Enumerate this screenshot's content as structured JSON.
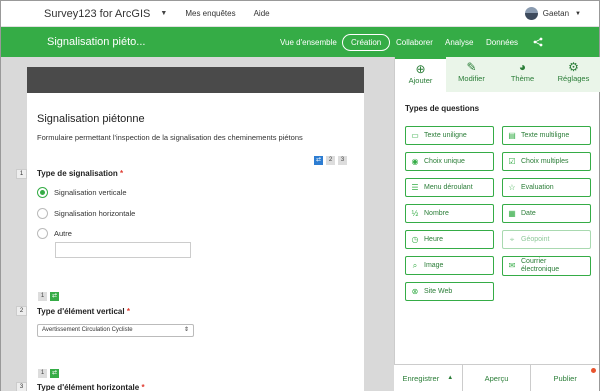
{
  "topbar": {
    "brand": "Survey123 for ArcGIS",
    "nav": [
      "Mes enquêtes",
      "Aide"
    ],
    "user": "Gaetan"
  },
  "greenbar": {
    "title": "Signalisation piéto...",
    "nav": [
      "Vue d'ensemble",
      "Création",
      "Collaborer",
      "Analyse",
      "Données"
    ],
    "active": "Création"
  },
  "form": {
    "title": "Signalisation piétonne",
    "description": "Formulaire permettant l'inspection de la signalisation des cheminements piétons",
    "q1": {
      "number": "1",
      "label": "Type de signalisation",
      "required_mark": "*",
      "options": [
        "Signalisation verticale",
        "Signalisation horizontale",
        "Autre"
      ],
      "selected": "Signalisation verticale",
      "badges": [
        "2",
        "3"
      ]
    },
    "q2": {
      "number": "2",
      "label": "Type d'élément vertical",
      "required_mark": "*",
      "badge": "1",
      "select_value": "Avertissement Circulation Cycliste"
    },
    "q3": {
      "number": "3",
      "label": "Type d'élément horizontale",
      "required_mark": "*",
      "badge": "1"
    }
  },
  "panel": {
    "tabs": [
      {
        "label": "Ajouter",
        "icon": "plus-circle-icon"
      },
      {
        "label": "Modifier",
        "icon": "pencil-icon"
      },
      {
        "label": "Thème",
        "icon": "palette-icon"
      },
      {
        "label": "Réglages",
        "icon": "settings-icon"
      }
    ],
    "active_tab": "Ajouter",
    "section_title": "Types de questions",
    "types": [
      {
        "label": "Texte uniligne",
        "icon": "text-line-icon"
      },
      {
        "label": "Texte multiligne",
        "icon": "text-multi-icon"
      },
      {
        "label": "Choix unique",
        "icon": "radio-icon"
      },
      {
        "label": "Choix multiples",
        "icon": "checkbox-icon"
      },
      {
        "label": "Menu déroulant",
        "icon": "dropdown-icon"
      },
      {
        "label": "Evaluation",
        "icon": "star-icon"
      },
      {
        "label": "Nombre",
        "icon": "number-icon"
      },
      {
        "label": "Date",
        "icon": "calendar-icon"
      },
      {
        "label": "Heure",
        "icon": "clock-icon"
      },
      {
        "label": "Géopoint",
        "icon": "location-icon",
        "disabled": true
      },
      {
        "label": "Image",
        "icon": "image-icon"
      },
      {
        "label": "Courrier électronique",
        "icon": "mail-icon"
      },
      {
        "label": "Site Web",
        "icon": "link-icon"
      }
    ]
  },
  "footer": {
    "save": "Enregistrer",
    "preview": "Aperçu",
    "publish": "Publier"
  },
  "colors": {
    "brand_green": "#35ac46",
    "dark_header": "#4a4a4a",
    "required": "#e03c31",
    "notify_dot": "#e8542e"
  }
}
